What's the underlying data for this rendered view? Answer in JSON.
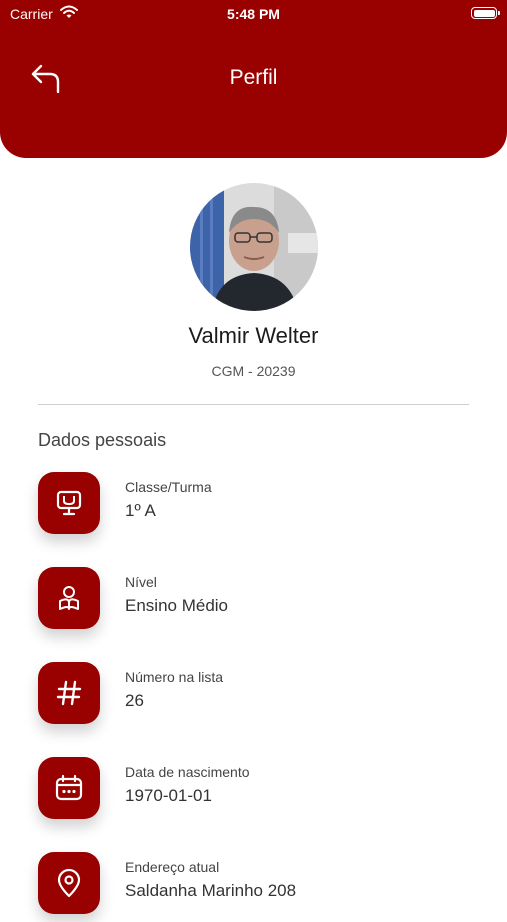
{
  "status_bar": {
    "carrier": "Carrier",
    "time": "5:48 PM"
  },
  "header": {
    "title": "Perfil",
    "back_icon": "back-arrow-icon"
  },
  "profile": {
    "name": "Valmir Welter",
    "id_text": "CGM - 20239"
  },
  "personal": {
    "section_title": "Dados pessoais",
    "items": [
      {
        "icon": "monitor-icon",
        "label": "Classe/Turma",
        "value": "1º A"
      },
      {
        "icon": "student-reading-icon",
        "label": "Nível",
        "value": "Ensino Médio"
      },
      {
        "icon": "hash-icon",
        "label": "Número na lista",
        "value": "26"
      },
      {
        "icon": "calendar-icon",
        "label": "Data de nascimento",
        "value": "1970-01-01"
      },
      {
        "icon": "location-pin-icon",
        "label": "Endereço atual",
        "value": "Saldanha Marinho 208"
      }
    ]
  },
  "colors": {
    "primary": "#990000",
    "background": "#ffffff"
  }
}
